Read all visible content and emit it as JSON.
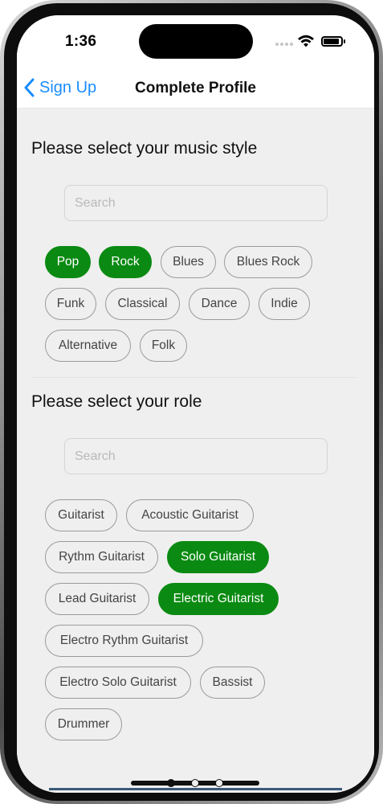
{
  "status": {
    "time": "1:36"
  },
  "nav": {
    "back_label": "Sign Up",
    "title": "Complete Profile"
  },
  "music": {
    "heading": "Please select your music style",
    "search_placeholder": "Search",
    "chips": [
      {
        "label": "Pop",
        "selected": true
      },
      {
        "label": "Rock",
        "selected": true
      },
      {
        "label": "Blues",
        "selected": false
      },
      {
        "label": "Blues Rock",
        "selected": false
      },
      {
        "label": "Funk",
        "selected": false
      },
      {
        "label": "Classical",
        "selected": false
      },
      {
        "label": "Dance",
        "selected": false
      },
      {
        "label": "Indie",
        "selected": false
      },
      {
        "label": "Alternative",
        "selected": false
      },
      {
        "label": "Folk",
        "selected": false
      }
    ]
  },
  "role": {
    "heading": "Please select your role",
    "search_placeholder": "Search",
    "chips": [
      {
        "label": "Guitarist",
        "selected": false
      },
      {
        "label": "Acoustic Guitarist",
        "selected": false
      },
      {
        "label": "Rythm Guitarist",
        "selected": false
      },
      {
        "label": "Solo Guitarist",
        "selected": true
      },
      {
        "label": "Lead Guitarist",
        "selected": false
      },
      {
        "label": "Electric Guitarist",
        "selected": true
      },
      {
        "label": "Electro Rythm Guitarist",
        "selected": false
      },
      {
        "label": "Electro Solo Guitarist",
        "selected": false
      },
      {
        "label": "Bassist",
        "selected": false
      },
      {
        "label": "Drummer",
        "selected": false
      }
    ]
  },
  "colors": {
    "accent": "#0a8a12",
    "link": "#1a8cff"
  }
}
